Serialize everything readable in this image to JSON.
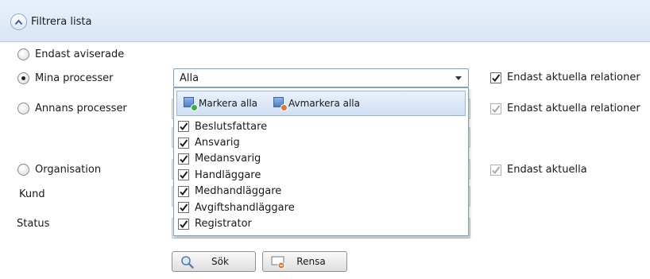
{
  "header": {
    "title": "Filtrera lista"
  },
  "filters": {
    "only_notified": {
      "label": "Endast aviserade",
      "selected": false
    },
    "my_processes": {
      "label": "Mina processer",
      "selected": true
    },
    "others_processes": {
      "label": "Annans processer",
      "selected": false
    },
    "organisation": {
      "label": "Organisation",
      "selected": false
    }
  },
  "fields": {
    "customer_label": "Kund",
    "status_label": "Status"
  },
  "role_select": {
    "value": "Alla",
    "dropdown": {
      "select_all_label": "Markera alla",
      "deselect_all_label": "Avmarkera alla",
      "items": [
        {
          "label": "Beslutsfattare",
          "checked": true
        },
        {
          "label": "Ansvarig",
          "checked": true
        },
        {
          "label": "Medansvarig",
          "checked": true
        },
        {
          "label": "Handläggare",
          "checked": true
        },
        {
          "label": "Medhandläggare",
          "checked": true
        },
        {
          "label": "Avgiftshandläggare",
          "checked": true
        },
        {
          "label": "Registrator",
          "checked": true
        }
      ]
    }
  },
  "checkboxes": {
    "current_relations_1": {
      "label": "Endast aktuella relationer",
      "checked": true,
      "enabled": true
    },
    "current_relations_2": {
      "label": "Endast aktuella relationer",
      "checked": true,
      "enabled": false
    },
    "current_only": {
      "label": "Endast aktuella",
      "checked": true,
      "enabled": false
    }
  },
  "buttons": {
    "search_label": "Sök",
    "clear_label": "Rensa"
  }
}
